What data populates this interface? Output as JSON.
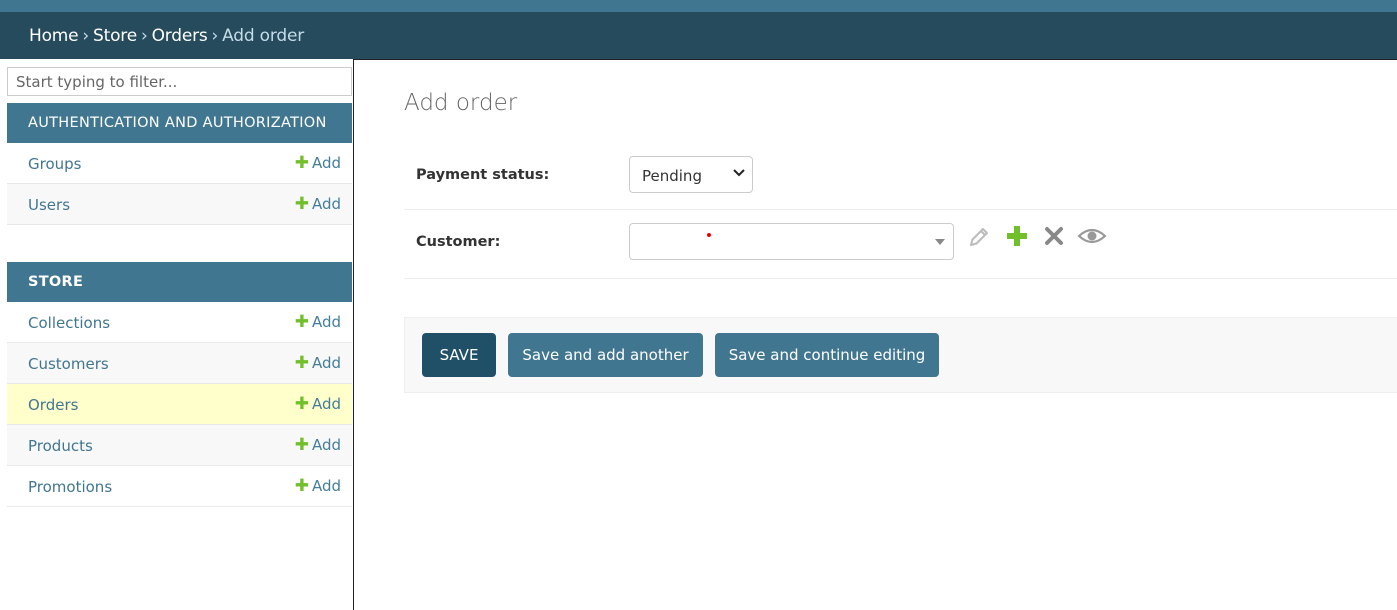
{
  "breadcrumbs": {
    "items": [
      "Home",
      "Store",
      "Orders"
    ],
    "separator": "›",
    "current": "Add order"
  },
  "sidebar": {
    "filter_placeholder": "Start typing to filter...",
    "modules": [
      {
        "title": "AUTHENTICATION AND AUTHORIZATION",
        "items": [
          {
            "label": "Groups",
            "add": "Add"
          },
          {
            "label": "Users",
            "add": "Add"
          }
        ]
      },
      {
        "title": "STORE",
        "items": [
          {
            "label": "Collections",
            "add": "Add"
          },
          {
            "label": "Customers",
            "add": "Add"
          },
          {
            "label": "Orders",
            "add": "Add",
            "current": true
          },
          {
            "label": "Products",
            "add": "Add"
          },
          {
            "label": "Promotions",
            "add": "Add"
          }
        ]
      }
    ]
  },
  "main": {
    "title": "Add order",
    "fields": {
      "payment_status": {
        "label": "Payment status:",
        "value": "Pending"
      },
      "customer": {
        "label": "Customer:",
        "value": ""
      }
    },
    "customer_actions": [
      "pencil-icon",
      "plus-icon",
      "x-icon",
      "eye-icon"
    ],
    "buttons": {
      "save": "SAVE",
      "save_add_another": "Save and add another",
      "save_continue": "Save and continue editing"
    }
  },
  "colors": {
    "header": "#264b5d",
    "accent": "#417690",
    "primary_button": "#205067",
    "add_green": "#70bf2b",
    "current_row": "#ffffcc"
  }
}
